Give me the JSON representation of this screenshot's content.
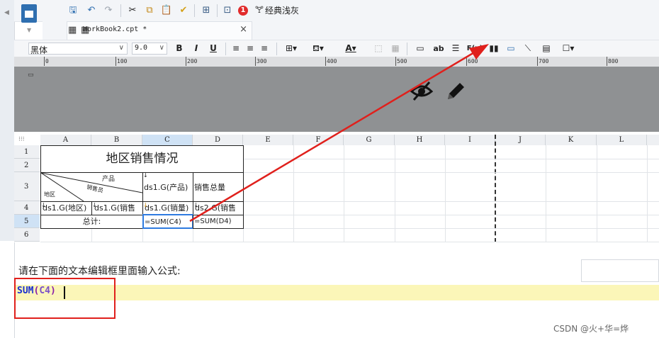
{
  "toolbar": {
    "theme_label": "经典浅灰",
    "notification_count": "1",
    "icons": [
      "save-icon",
      "undo-icon",
      "redo-icon",
      "cut-icon",
      "copy-icon",
      "paste-icon",
      "format-brush-icon",
      "preview-icon",
      "design-icon",
      "notification-icon",
      "theme-icon"
    ]
  },
  "tab": {
    "title": "WorkBook2.cpt *",
    "close": "×"
  },
  "format": {
    "font": "黑体",
    "size": "9.0",
    "bold": "B",
    "italic": "I",
    "underline": "U",
    "text_label": "ab",
    "formula_label": "F(x)"
  },
  "ruler": {
    "ticks": [
      "0",
      "100",
      "200",
      "300",
      "400",
      "500",
      "600",
      "700",
      "800"
    ]
  },
  "sheet": {
    "columns": [
      "A",
      "B",
      "C",
      "D",
      "E",
      "F",
      "G",
      "H",
      "I",
      "J",
      "K",
      "L"
    ],
    "rows": [
      "1",
      "2",
      "3",
      "4",
      "5",
      "6"
    ],
    "corner": "⁝⁝⁝",
    "title": "地区销售情况",
    "slash_top": "产品",
    "slash_mid": "销售员",
    "slash_bottom": "地区",
    "c3": "ds1.G(产品)",
    "d3": "销售总量",
    "a4": "ds1.G(地区)",
    "b4": "ds1.G(销售",
    "c4": "ds1.G(销量)",
    "d4": "ds2.G(销售",
    "ab5": "总计:",
    "c5": "=SUM(C4)",
    "d5": "=SUM(D4)"
  },
  "formula_panel": {
    "prompt": "请在下面的文本编辑框里面输入公式:",
    "func": "SUM",
    "open": "(",
    "arg": "C4",
    "close": ")"
  },
  "watermark": "CSDN @火+华=烨",
  "colors": {
    "accent": "#2f6fb0",
    "highlight": "#e0201c",
    "editor_bg": "#fbf6b8"
  }
}
